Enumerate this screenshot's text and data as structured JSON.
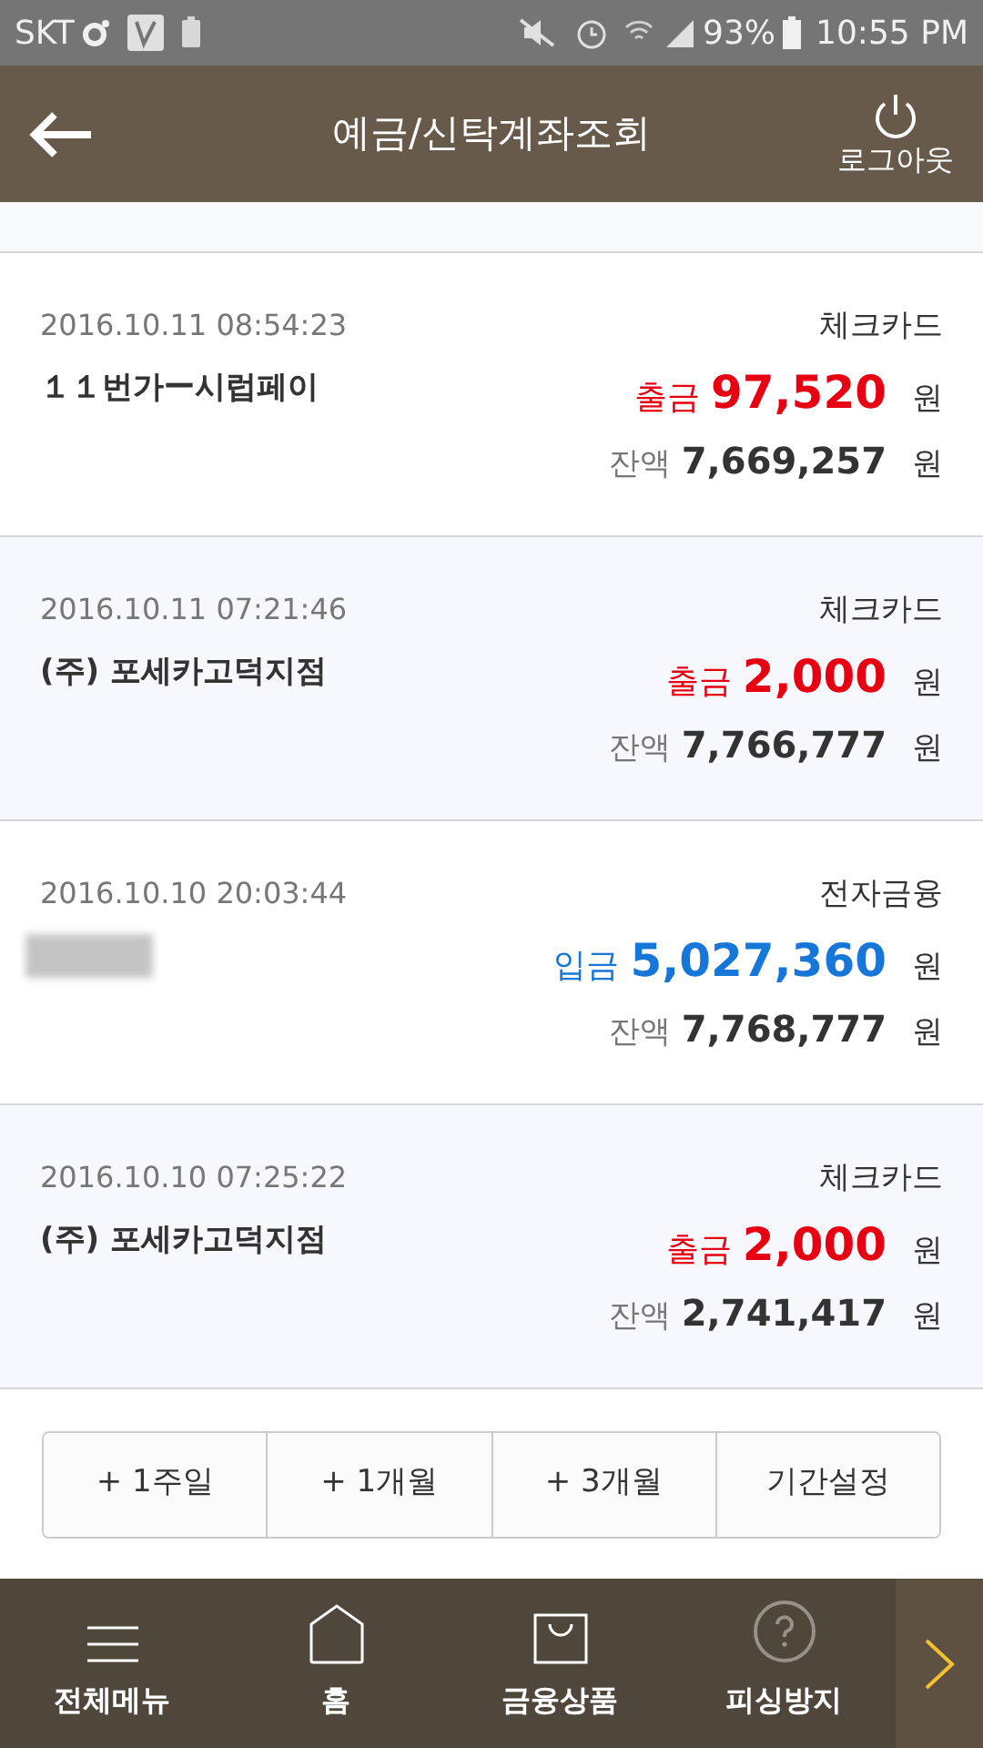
{
  "status_bar": {
    "carrier": "SKT",
    "battery": "93%",
    "time": "10:55 PM"
  },
  "header": {
    "title": "예금/신탁계좌조회",
    "logout": "로그아웃"
  },
  "transactions": [
    {
      "datetime": "2016.10.11 08:54:23",
      "merchant": "１１번가ー시럽페이",
      "category": "체크카드",
      "kind": "withdrawal",
      "type_label": "출금",
      "amount": "97,520",
      "unit": "원",
      "balance_label": "잔액",
      "balance": "7,669,257",
      "balance_unit": "원"
    },
    {
      "datetime": "2016.10.11 07:21:46",
      "merchant": "(주) 포세카고덕지점",
      "category": "체크카드",
      "kind": "withdrawal",
      "type_label": "출금",
      "amount": "2,000",
      "unit": "원",
      "balance_label": "잔액",
      "balance": "7,766,777",
      "balance_unit": "원"
    },
    {
      "datetime": "2016.10.10 20:03:44",
      "redacted": true,
      "category": "전자금융",
      "kind": "deposit",
      "type_label": "입금",
      "amount": "5,027,360",
      "unit": "원",
      "balance_label": "잔액",
      "balance": "7,768,777",
      "balance_unit": "원"
    },
    {
      "datetime": "2016.10.10 07:25:22",
      "merchant": "(주) 포세카고덕지점",
      "category": "체크카드",
      "kind": "withdrawal",
      "type_label": "출금",
      "amount": "2,000",
      "unit": "원",
      "balance_label": "잔액",
      "balance": "2,741,417",
      "balance_unit": "원"
    }
  ],
  "period_buttons": [
    "+ 1주일",
    "+ 1개월",
    "+ 3개월",
    "기간설정"
  ],
  "bottom_nav": [
    {
      "kind": "menu",
      "label": "전체메뉴"
    },
    {
      "kind": "home",
      "label": "홈"
    },
    {
      "kind": "bag",
      "label": "금융상품"
    },
    {
      "kind": "help",
      "label": "피싱방지"
    }
  ]
}
